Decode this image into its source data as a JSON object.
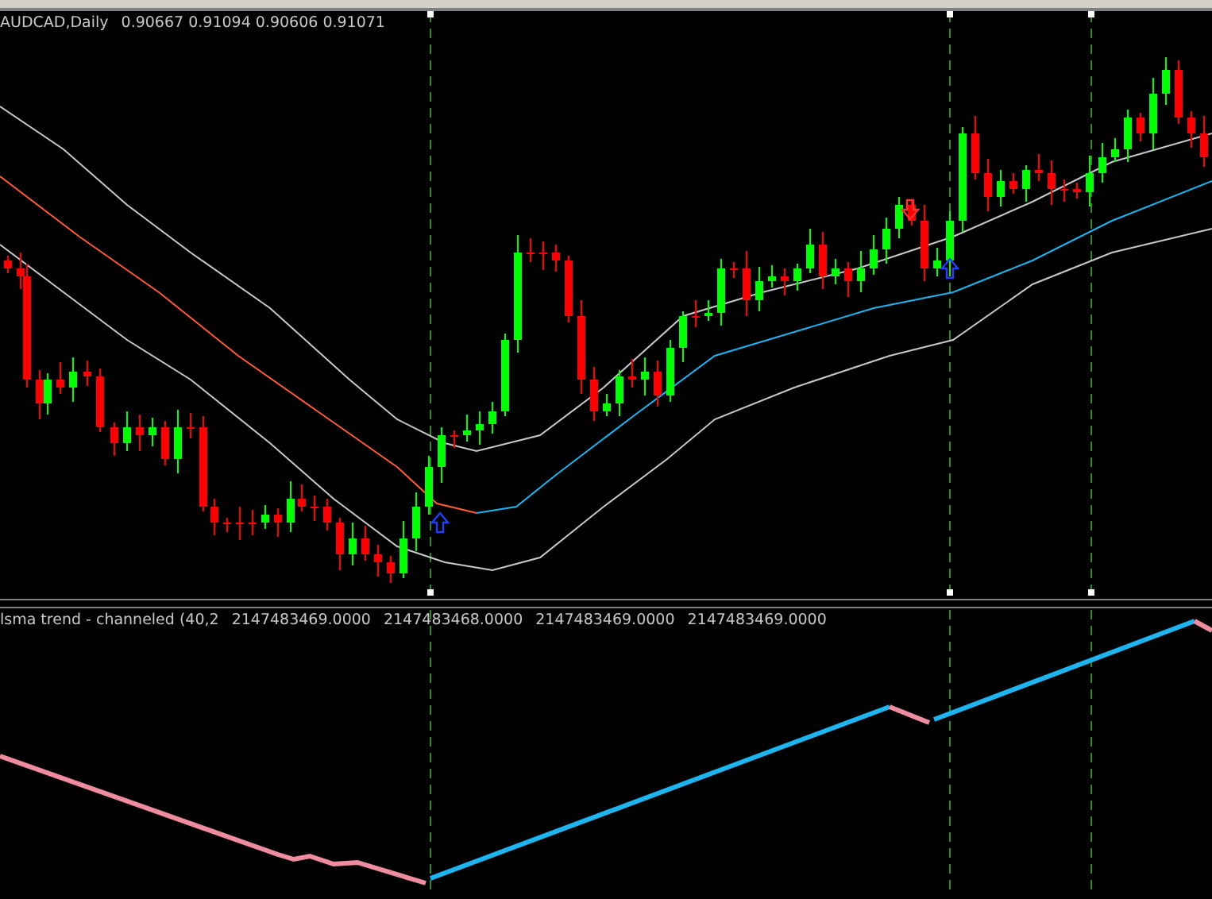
{
  "chart": {
    "symbol_label": "AUDCAD,Daily",
    "ohlc": "0.90667 0.91094 0.90606 0.91071"
  },
  "indicator": {
    "label": "lsma trend - channeled (40,2",
    "values": [
      "2147483469.0000",
      "2147483468.0000",
      "2147483469.0000",
      "2147483469.0000"
    ]
  }
}
